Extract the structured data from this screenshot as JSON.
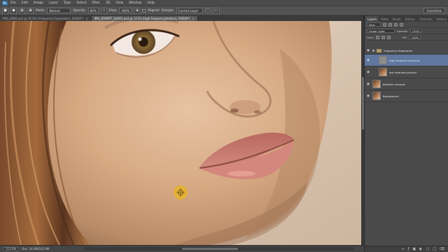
{
  "app": {
    "logo": "Ps"
  },
  "menu": [
    "File",
    "Edit",
    "Image",
    "Layer",
    "Type",
    "Select",
    "Filter",
    "3D",
    "View",
    "Window",
    "Help"
  ],
  "options": {
    "mode_label": "Mode:",
    "mode_value": "Normal",
    "opacity_label": "Opacity:",
    "opacity_value": "80%",
    "flow_label": "Flow:",
    "flow_value": "100%",
    "aligned_label": "Aligned",
    "sample_label": "Sample:",
    "sample_value": "Current Layer",
    "workspace": "Essentials"
  },
  "tabs": [
    {
      "label": "IMG_8589.psd @ 16.9% (Frequency Separation, RGB/8*)",
      "active": false
    },
    {
      "label": "IMG_8589PT_Soft01.psd @ 111% (high frequency/texture, RGB/8*)",
      "active": true
    }
  ],
  "status": {
    "zoom": "111.9%",
    "doc": "Doc: 34.0M/102.4M"
  },
  "panel": {
    "tabs": [
      "Layers",
      "Paths",
      "Brush",
      "History",
      "Channels",
      "Actions"
    ],
    "kind_label": "Kind",
    "blend_mode": "Linear Light",
    "opacity_label": "Opacity:",
    "opacity_value": "100%",
    "lock_label": "Lock:",
    "fill_label": "Fill:",
    "fill_value": "100%",
    "group_name": "Frequency Separation",
    "layers": [
      {
        "name": "high frequency/texture",
        "selected": true
      },
      {
        "name": "low frequency/colour",
        "selected": false
      },
      {
        "name": "blemish removal",
        "selected": false
      },
      {
        "name": "Background",
        "selected": false
      }
    ]
  },
  "colors": {
    "accent": "#6077a0",
    "cursor": "#e6b32a"
  },
  "icons": [
    "photoshop-logo",
    "clone-stamp-icon",
    "brush-panel-icon",
    "eye-icon",
    "folder-icon",
    "new-layer-icon",
    "trash-icon",
    "cursor-target-icon"
  ]
}
